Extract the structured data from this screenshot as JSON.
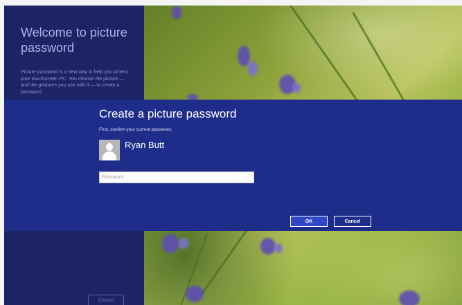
{
  "welcome_panel": {
    "title": "Welcome to picture password",
    "description": "Picture password is a new way to help you protect your touchscreen PC. You choose the picture — and the gestures you use with it — to create a password",
    "cancel_label": "Cancel"
  },
  "dialog": {
    "title": "Create a picture password",
    "subtitle": "First, confirm your current password.",
    "user_name": "Ryan Butt",
    "password_placeholder": "Password",
    "password_value": "",
    "ok_label": "OK",
    "cancel_label": "Cancel"
  },
  "colors": {
    "left_panel": "#1d2466",
    "dialog_band": "#1f2d8a",
    "ok_button": "#2f48c7"
  }
}
